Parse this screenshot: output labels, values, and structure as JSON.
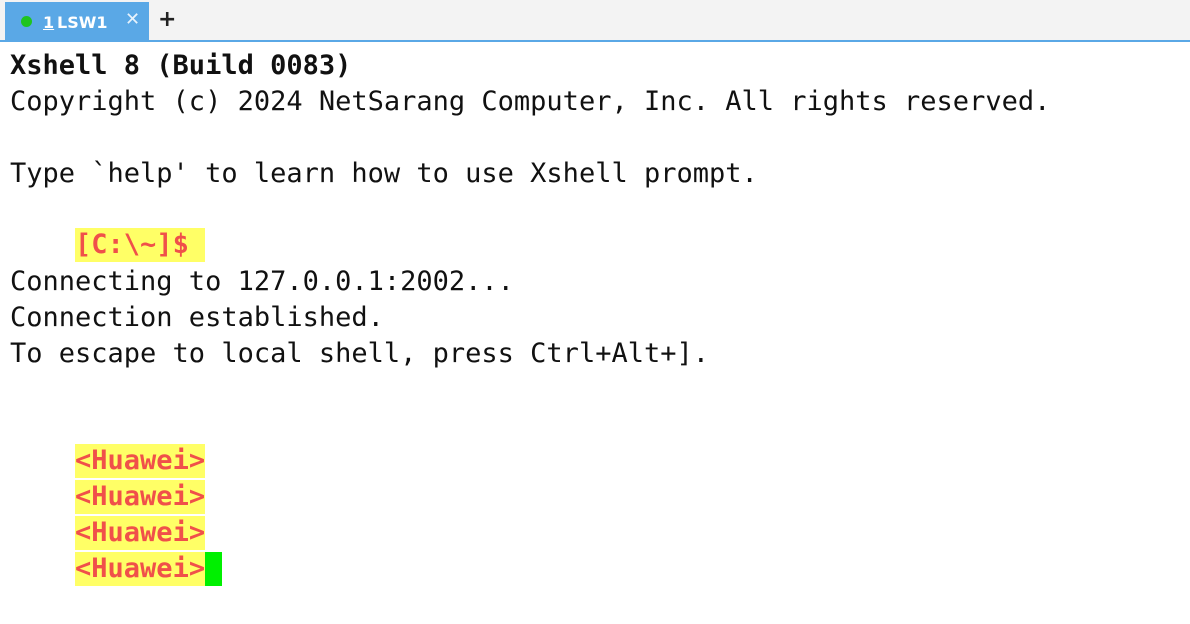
{
  "tab": {
    "number": "1",
    "name": "LSW1",
    "close_glyph": "✕",
    "status_color": "#1fc41f"
  },
  "new_tab_glyph": "+",
  "colors": {
    "tab_active": "#5aa8e6",
    "prompt_bg": "#ffff66",
    "prompt_fg": "#f0504a",
    "cursor": "#00f000"
  },
  "terminal": {
    "banner_title": "Xshell 8 (Build 0083)",
    "copyright": "Copyright (c) 2024 NetSarang Computer, Inc. All rights reserved.",
    "help_hint": "Type `help' to learn how to use Xshell prompt.",
    "local_prompt": "[C:\\~]$ ",
    "connecting": "Connecting to 127.0.0.1:2002...",
    "established": "Connection established.",
    "escape_hint": "To escape to local shell, press Ctrl+Alt+].",
    "device_prompts": [
      "<Huawei>",
      "<Huawei>",
      "<Huawei>",
      "<Huawei>"
    ]
  }
}
